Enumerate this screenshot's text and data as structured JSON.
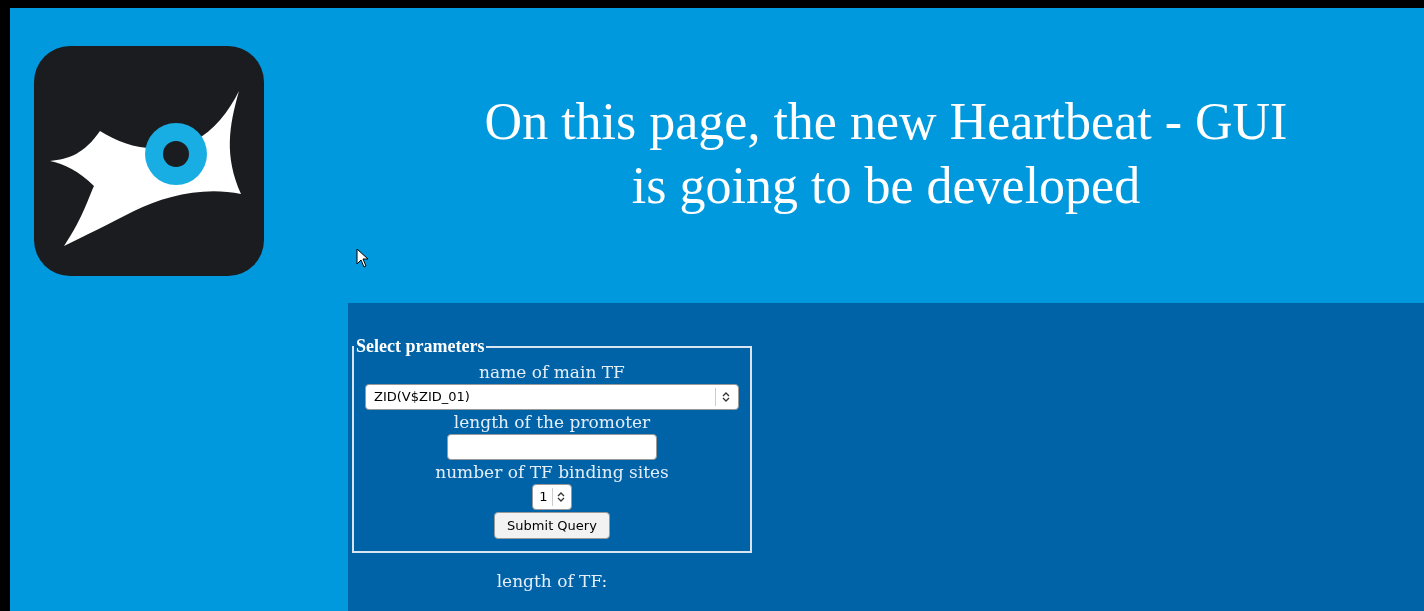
{
  "header": {
    "title_lines": [
      "On this page, the new Heartbeat - GUI",
      "is going to be developed"
    ]
  },
  "form": {
    "legend": "Select prameters",
    "fields": [
      {
        "kind": "select",
        "label": "name of main TF",
        "value": "ZID(V$ZID_01)"
      },
      {
        "kind": "text",
        "label": "length of the promoter"
      },
      {
        "kind": "number",
        "label": "number of TF binding sites",
        "value": "1"
      }
    ],
    "submit": "Submit Query"
  },
  "result": {
    "label": "length of TF:"
  }
}
